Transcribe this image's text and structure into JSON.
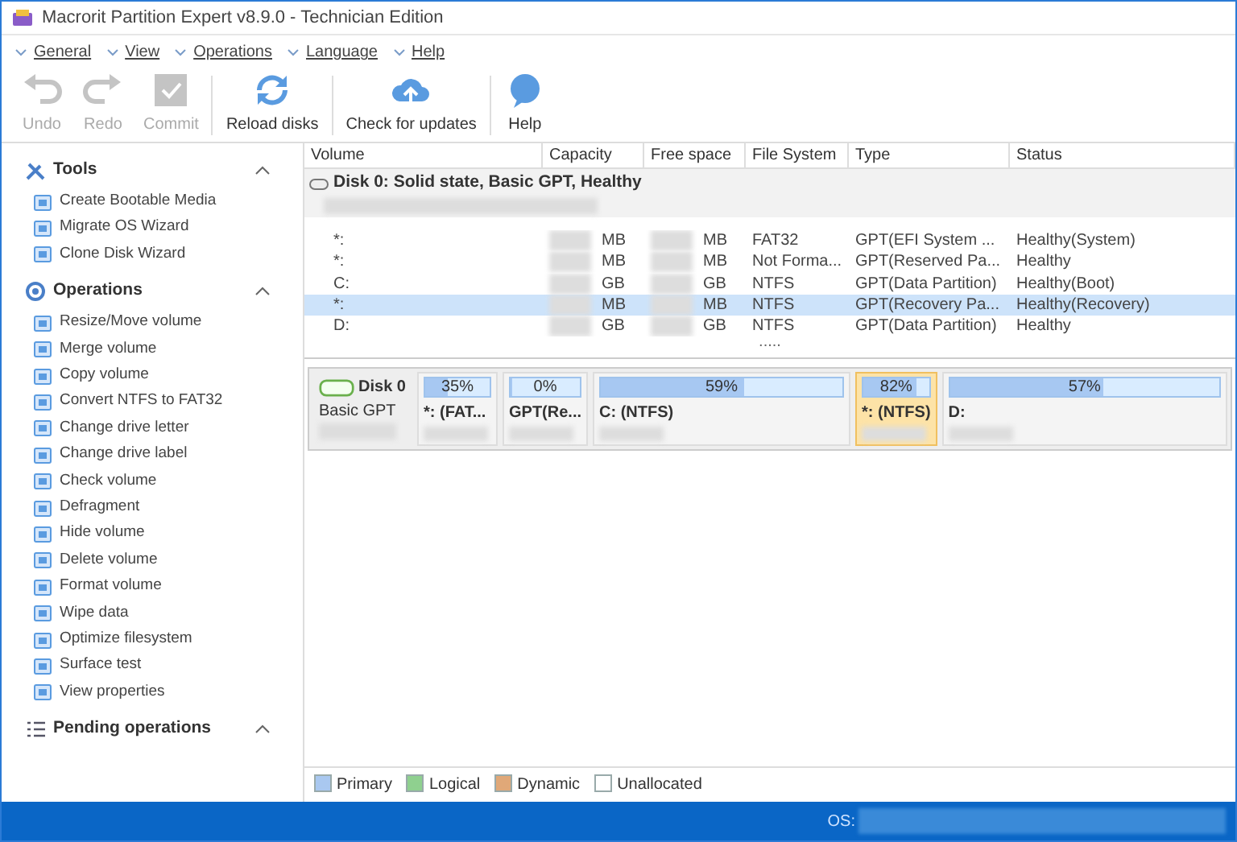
{
  "window": {
    "title": "Macrorit Partition Expert v8.9.0 - Technician Edition"
  },
  "menu": [
    {
      "label": "General"
    },
    {
      "label": "View"
    },
    {
      "label": "Operations"
    },
    {
      "label": "Language"
    },
    {
      "label": "Help"
    }
  ],
  "toolbar": [
    {
      "label": "Undo",
      "kind": "undo",
      "disabled": true
    },
    {
      "label": "Redo",
      "kind": "redo",
      "disabled": true
    },
    {
      "label": "Commit",
      "kind": "commit",
      "disabled": true
    },
    {
      "label": "Reload disks",
      "kind": "reload",
      "disabled": false
    },
    {
      "label": "Check for updates",
      "kind": "cloud",
      "disabled": false
    },
    {
      "label": "Help",
      "kind": "help",
      "disabled": false
    }
  ],
  "sidebar": [
    {
      "title": "Tools",
      "expanded": true,
      "items": [
        "Create Bootable Media",
        "Migrate OS Wizard",
        "Clone Disk Wizard"
      ]
    },
    {
      "title": "Operations",
      "expanded": true,
      "items": [
        "Resize/Move volume",
        "Merge volume",
        "Copy volume",
        "Convert NTFS to FAT32",
        "Change drive letter",
        "Change drive label",
        "Check volume",
        "Defragment",
        "Hide volume",
        "Delete volume",
        "Format volume",
        "Wipe data",
        "Optimize filesystem",
        "Surface test",
        "View properties"
      ]
    },
    {
      "title": "Pending operations",
      "expanded": true
    }
  ],
  "table": {
    "columns": [
      "Volume",
      "Capacity",
      "Free space",
      "File System",
      "Type",
      "Status"
    ],
    "disk": "Disk 0: Solid state, Basic GPT, Healthy",
    "rows": [
      {
        "volume": "*:",
        "capacity": "MB",
        "free": "MB",
        "file_system": "FAT32",
        "type": "GPT(EFI System ...",
        "status": "Healthy(System)",
        "selected": false
      },
      {
        "volume": "*:",
        "capacity": "MB",
        "free": "MB",
        "file_system": "Not Forma...",
        "type": "GPT(Reserved Pa...",
        "status": "Healthy",
        "selected": false
      },
      {
        "volume": "C:",
        "capacity": "GB",
        "free": "GB",
        "file_system": "NTFS",
        "type": "GPT(Data Partition)",
        "status": "Healthy(Boot)",
        "selected": false
      },
      {
        "volume": "*:",
        "capacity": "MB",
        "free": "MB",
        "file_system": "NTFS",
        "type": "GPT(Recovery Pa...",
        "status": "Healthy(Recovery)",
        "selected": true
      },
      {
        "volume": "D:",
        "capacity": "GB",
        "free": "GB",
        "file_system": "NTFS",
        "type": "GPT(Data Partition)",
        "status": "Healthy",
        "selected": false
      }
    ]
  },
  "splitter": ".....",
  "disk_map": {
    "name": "Disk 0",
    "scheme": "Basic GPT",
    "partitions": [
      {
        "percent": "35%",
        "level": 0.35,
        "label": "*: (FAT...",
        "selected": false
      },
      {
        "percent": "0%",
        "level": 0.0,
        "label": "GPT(Re...",
        "selected": false
      },
      {
        "percent": "59%",
        "level": 0.59,
        "label": "C: (NTFS)",
        "selected": false
      },
      {
        "percent": "82%",
        "level": 0.82,
        "label": "*: (NTFS)",
        "selected": true
      },
      {
        "percent": "57%",
        "level": 0.57,
        "label": "D:",
        "selected": false
      }
    ]
  },
  "legend": [
    {
      "label": "Primary",
      "color": "#a9c8f0"
    },
    {
      "label": "Logical",
      "color": "#8fd08f"
    },
    {
      "label": "Dynamic",
      "color": "#e0a878"
    },
    {
      "label": "Unallocated",
      "color": "#ffffff"
    }
  ],
  "status_bar": {
    "label": "OS:"
  }
}
